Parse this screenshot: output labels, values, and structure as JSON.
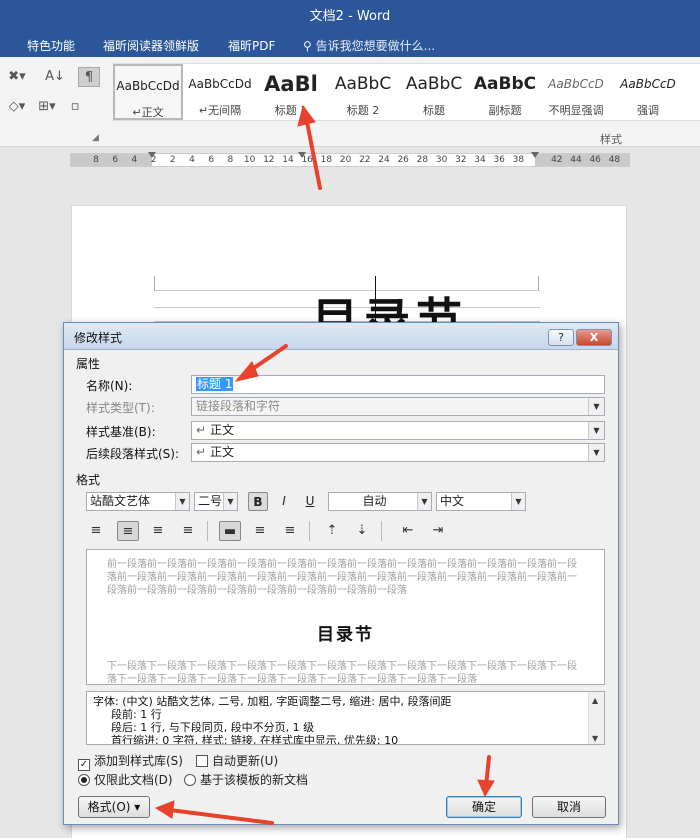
{
  "window": {
    "title": "文档2 - Word"
  },
  "menubar": {
    "items": [
      "特色功能",
      "福昕阅读器领鲜版",
      "福昕PDF"
    ],
    "tell_me": "告诉我您想要做什么..."
  },
  "ribbon": {
    "styles": [
      {
        "preview": "AaBbCcDd",
        "label": "正文",
        "selected": true
      },
      {
        "preview": "AaBbCcDd",
        "label": "无间隔"
      },
      {
        "preview": "AaBl",
        "label": "标题 1"
      },
      {
        "preview": "AaBbC",
        "label": "标题 2"
      },
      {
        "preview": "AaBbC",
        "label": "标题"
      },
      {
        "preview": "AaBbC",
        "label": "副标题"
      },
      {
        "preview": "AaBbCcD",
        "label": "不明显强调"
      },
      {
        "preview": "AaBbCcD",
        "label": "强调"
      }
    ],
    "group_label": "样式",
    "paragraph_mark": "↵"
  },
  "ruler": {
    "ticks": [
      "8",
      "6",
      "4",
      "2",
      "2",
      "4",
      "6",
      "8",
      "10",
      "12",
      "14",
      "16",
      "18",
      "20",
      "22",
      "24",
      "26",
      "28",
      "30",
      "32",
      "34",
      "36",
      "38",
      "42",
      "44",
      "46",
      "48"
    ]
  },
  "document": {
    "heading": "目录节"
  },
  "dialog": {
    "title": "修改样式",
    "help_label": "?",
    "close_label": "X",
    "properties_section": "属性",
    "name_label": "名称(N):",
    "name_value": "标题 1",
    "type_label": "样式类型(T):",
    "type_value": "链接段落和字符",
    "based_label": "样式基准(B):",
    "based_value": "正文",
    "next_label": "后续段落样式(S):",
    "next_value": "正文",
    "format_section": "格式",
    "font": "站酷文艺体",
    "size": "二号",
    "bold": "B",
    "italic": "I",
    "underline": "U",
    "color": "自动",
    "script": "中文",
    "preview_before": "前一段落前一段落前一段落前一段落前一段落前一段落前一段落前一段落前一段落前一段落前一段落前一段落前一段落前一段落前一段落前一段落前一段落前一段落前一段落前一段落前一段落前一段落前一段落前一段落前一段落前一段落前一段落前一段落前一段落前一段落前一段落",
    "preview_heading": "目录节",
    "preview_after": "下一段落下一段落下一段落下一段落下一段落下一段落下一段落下一段落下一段落下一段落下一段落下一段落下一段落下一段落下一段落下一段落下一段落下一段落下一段落下一段落下一段落",
    "desc_line1": "字体: (中文) 站酷文艺体, 二号, 加粗, 字距调整二号, 缩进: 居中, 段落间距",
    "desc_line2": "段前: 1 行",
    "desc_line3": "段后: 1 行, 与下段同页, 段中不分页, 1 级",
    "desc_line4": "首行缩进: 0 字符, 样式: 链接, 在样式库中显示, 优先级: 10",
    "add_to_gallery": "添加到样式库(S)",
    "auto_update": "自动更新(U)",
    "only_this_doc": "仅限此文档(D)",
    "new_docs": "基于该模板的新文档",
    "format_button": "格式(O) ▾",
    "ok_button": "确定",
    "cancel_button": "取消"
  },
  "colors": {
    "accent": "#2b579a",
    "annotation": "#e8412c"
  }
}
